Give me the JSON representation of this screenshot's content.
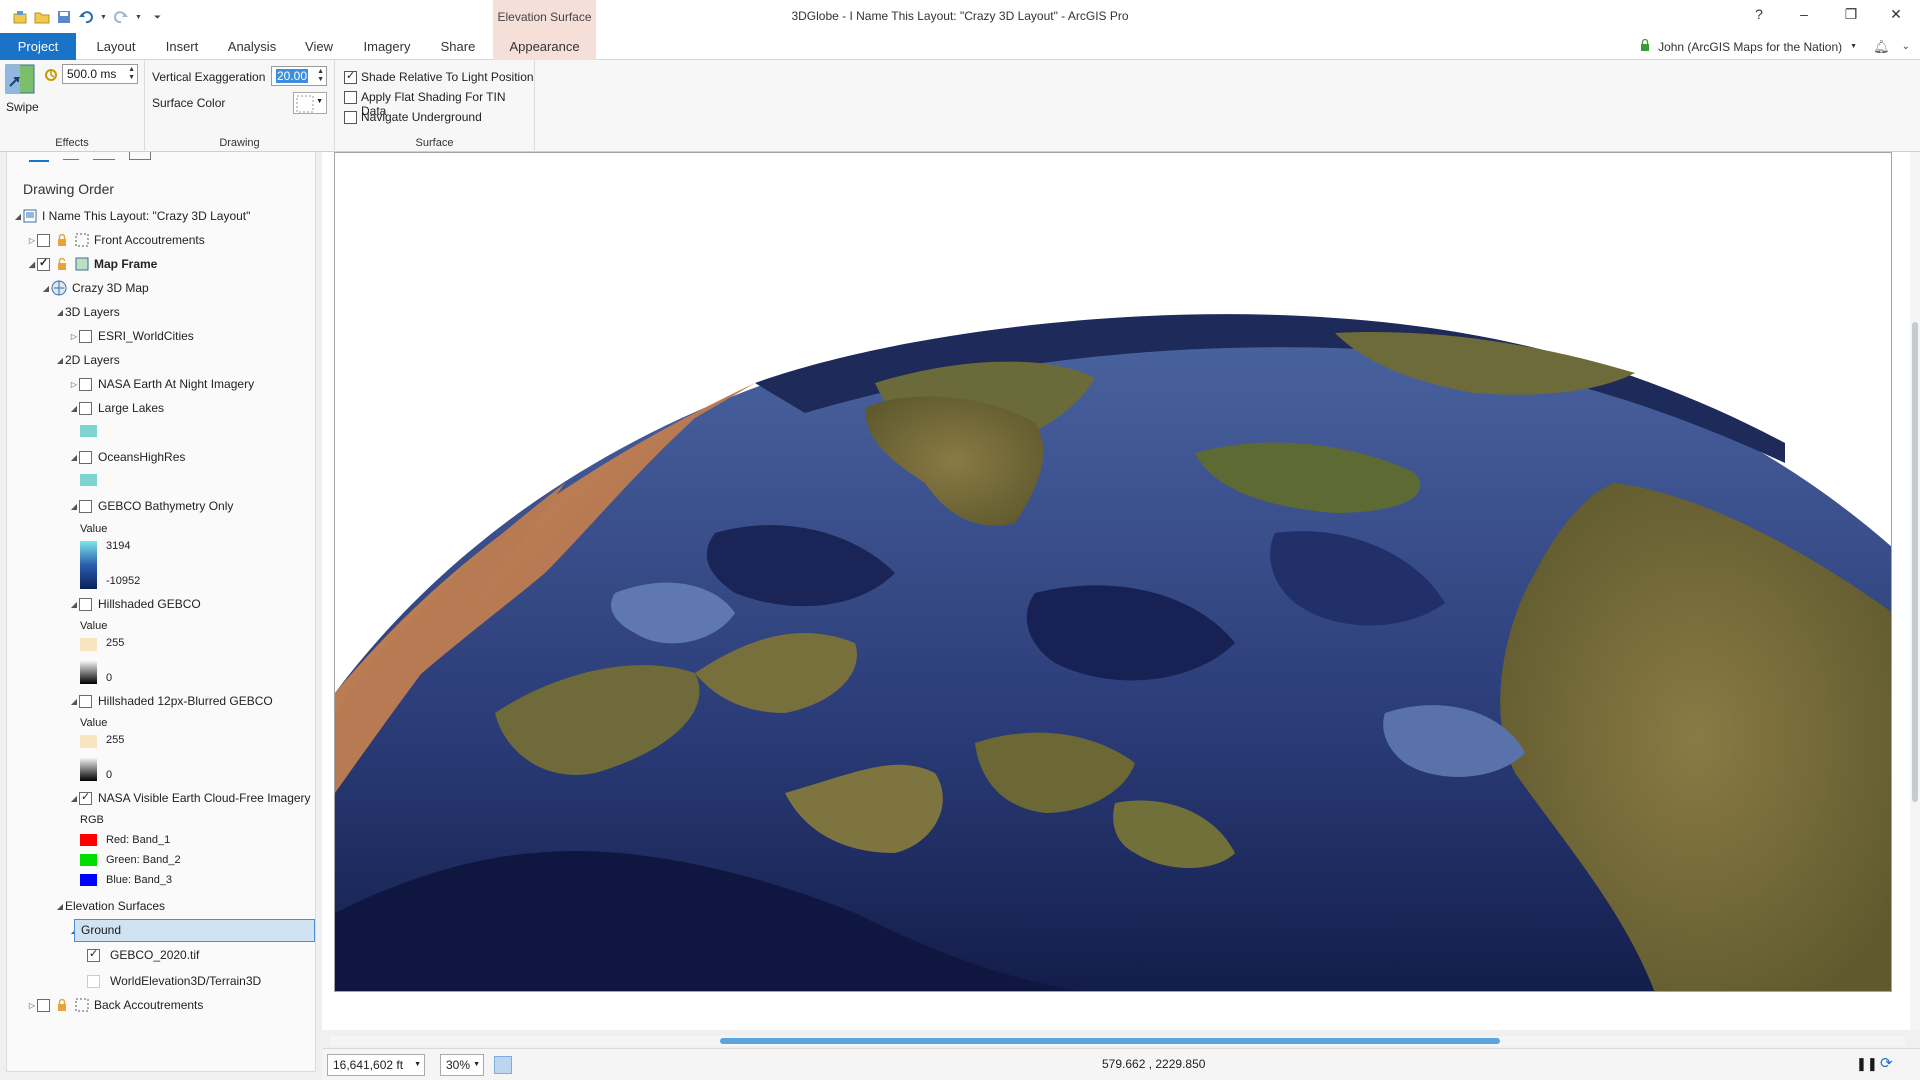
{
  "app": {
    "title": "3DGlobe - I Name This Layout: \"Crazy 3D Layout\" - ArcGIS Pro",
    "contextual_tab_group": "Elevation Surface",
    "help": "?",
    "minimize": "–",
    "restore": "❐",
    "close": "✕"
  },
  "tabs": [
    {
      "label": "Project"
    },
    {
      "label": "Layout"
    },
    {
      "label": "Insert"
    },
    {
      "label": "Analysis"
    },
    {
      "label": "View"
    },
    {
      "label": "Imagery"
    },
    {
      "label": "Share"
    },
    {
      "label": "Appearance"
    }
  ],
  "user": {
    "name": "John (ArcGIS Maps for the Nation)"
  },
  "ribbon": {
    "effects": {
      "swipe_label": "Swipe",
      "flicker_value": "500.0  ms",
      "group_label": "Effects"
    },
    "drawing": {
      "vertical_exaggeration_label": "Vertical Exaggeration",
      "vertical_exaggeration_value": "20.00",
      "surface_color_label": "Surface Color",
      "group_label": "Drawing"
    },
    "surface": {
      "shade_relative_label": "Shade Relative To Light Position",
      "shade_relative_checked": true,
      "apply_flat_label": "Apply Flat Shading For TIN Data",
      "apply_flat_checked": false,
      "navigate_label": "Navigate Underground",
      "navigate_checked": false,
      "group_label": "Surface"
    }
  },
  "contents": {
    "title": "Drawing Order",
    "layout_name": "I Name This Layout: \"Crazy 3D Layout\"",
    "front": "Front Accoutrements",
    "map_frame": "Map Frame",
    "map": "Crazy 3D Map",
    "layers_3d": "3D Layers",
    "world_cities": "ESRI_WorldCities",
    "layers_2d": "2D Layers",
    "nasa_night": "NASA Earth At Night Imagery",
    "large_lakes": "Large Lakes",
    "oceans": "OceansHighRes",
    "gebco_bathy": "GEBCO Bathymetry Only",
    "value_label": "Value",
    "bathy_high": "3194",
    "bathy_low": "-10952",
    "hillshade": "Hillshaded GEBCO",
    "hs_high": "255",
    "hs_low": "0",
    "hillshade_blur": "Hillshaded 12px-Blurred GEBCO",
    "nasa_visible": "NASA Visible Earth Cloud-Free Imagery",
    "rgb": "RGB",
    "red": "Red:   Band_1",
    "green": "Green:  Band_2",
    "blue": "Blue:   Band_3",
    "elev_surfaces": "Elevation Surfaces",
    "ground": "Ground",
    "gebco_tif": "GEBCO_2020.tif",
    "terrain": "WorldElevation3D/Terrain3D",
    "back": "Back Accoutrements"
  },
  "colors": {
    "project_tab": "#1a73c7",
    "contextual": "#f6ded9",
    "lake_swatch": "#7fd3d3",
    "red_band": "#ff0000",
    "green_band": "#00dd00",
    "blue_band": "#0000ff",
    "selection": "#cfe3f3"
  },
  "status": {
    "scale": "16,641,602 ft",
    "zoom": "30%",
    "coordinates": "579.662 , 2229.850"
  }
}
